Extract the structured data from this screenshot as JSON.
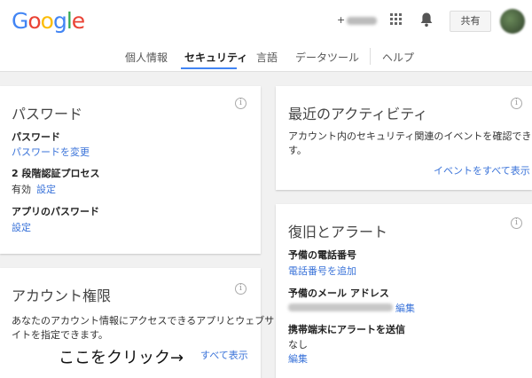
{
  "header": {
    "logo_letters": [
      "G",
      "o",
      "o",
      "g",
      "l",
      "e"
    ],
    "logo_colors": [
      "#4285f4",
      "#ea4335",
      "#fbbc05",
      "#4285f4",
      "#34a853",
      "#ea4335"
    ],
    "user_link_prefix": "+",
    "share_label": "共有"
  },
  "nav": {
    "items": [
      "個人情報",
      "セキュリティ",
      "言語",
      "データツール",
      "ヘルプ"
    ],
    "active_index": 1
  },
  "cards": {
    "password": {
      "title": "パスワード",
      "info": "i",
      "password_label": "パスワード",
      "change_password_link": "パスワードを変更",
      "two_step_label": "2 段階認証プロセス",
      "two_step_status": "有効",
      "two_step_settings_link": "設定",
      "app_password_label": "アプリのパスワード",
      "app_password_settings_link": "設定"
    },
    "account_permissions": {
      "title": "アカウント権限",
      "info": "i",
      "description_line1": "あなたのアカウント情報にアクセスできるアプリとウェブサ",
      "description_line2": "イトを指定できます。",
      "show_all_link": "すべて表示"
    },
    "recent_activity": {
      "title": "最近のアクティビティ",
      "info": "i",
      "description_line1": "アカウント内のセキュリティ関連のイベントを確認できま",
      "description_line2": "す。",
      "show_all_events_link": "イベントをすべて表示"
    },
    "recovery": {
      "title": "復旧とアラート",
      "info": "i",
      "phone_label": "予備の電話番号",
      "add_phone_link": "電話番号を追加",
      "email_label": "予備のメール アドレス",
      "email_edit_link": "編集",
      "mobile_alert_label": "携帯端末にアラートを送信",
      "mobile_alert_value": "なし",
      "mobile_alert_edit_link": "編集"
    }
  },
  "annotation": {
    "text": "ここをクリック→"
  },
  "colors": {
    "link": "#3a73d9",
    "nav_underline": "#4285f4",
    "page_bg": "#f1f1f1"
  }
}
